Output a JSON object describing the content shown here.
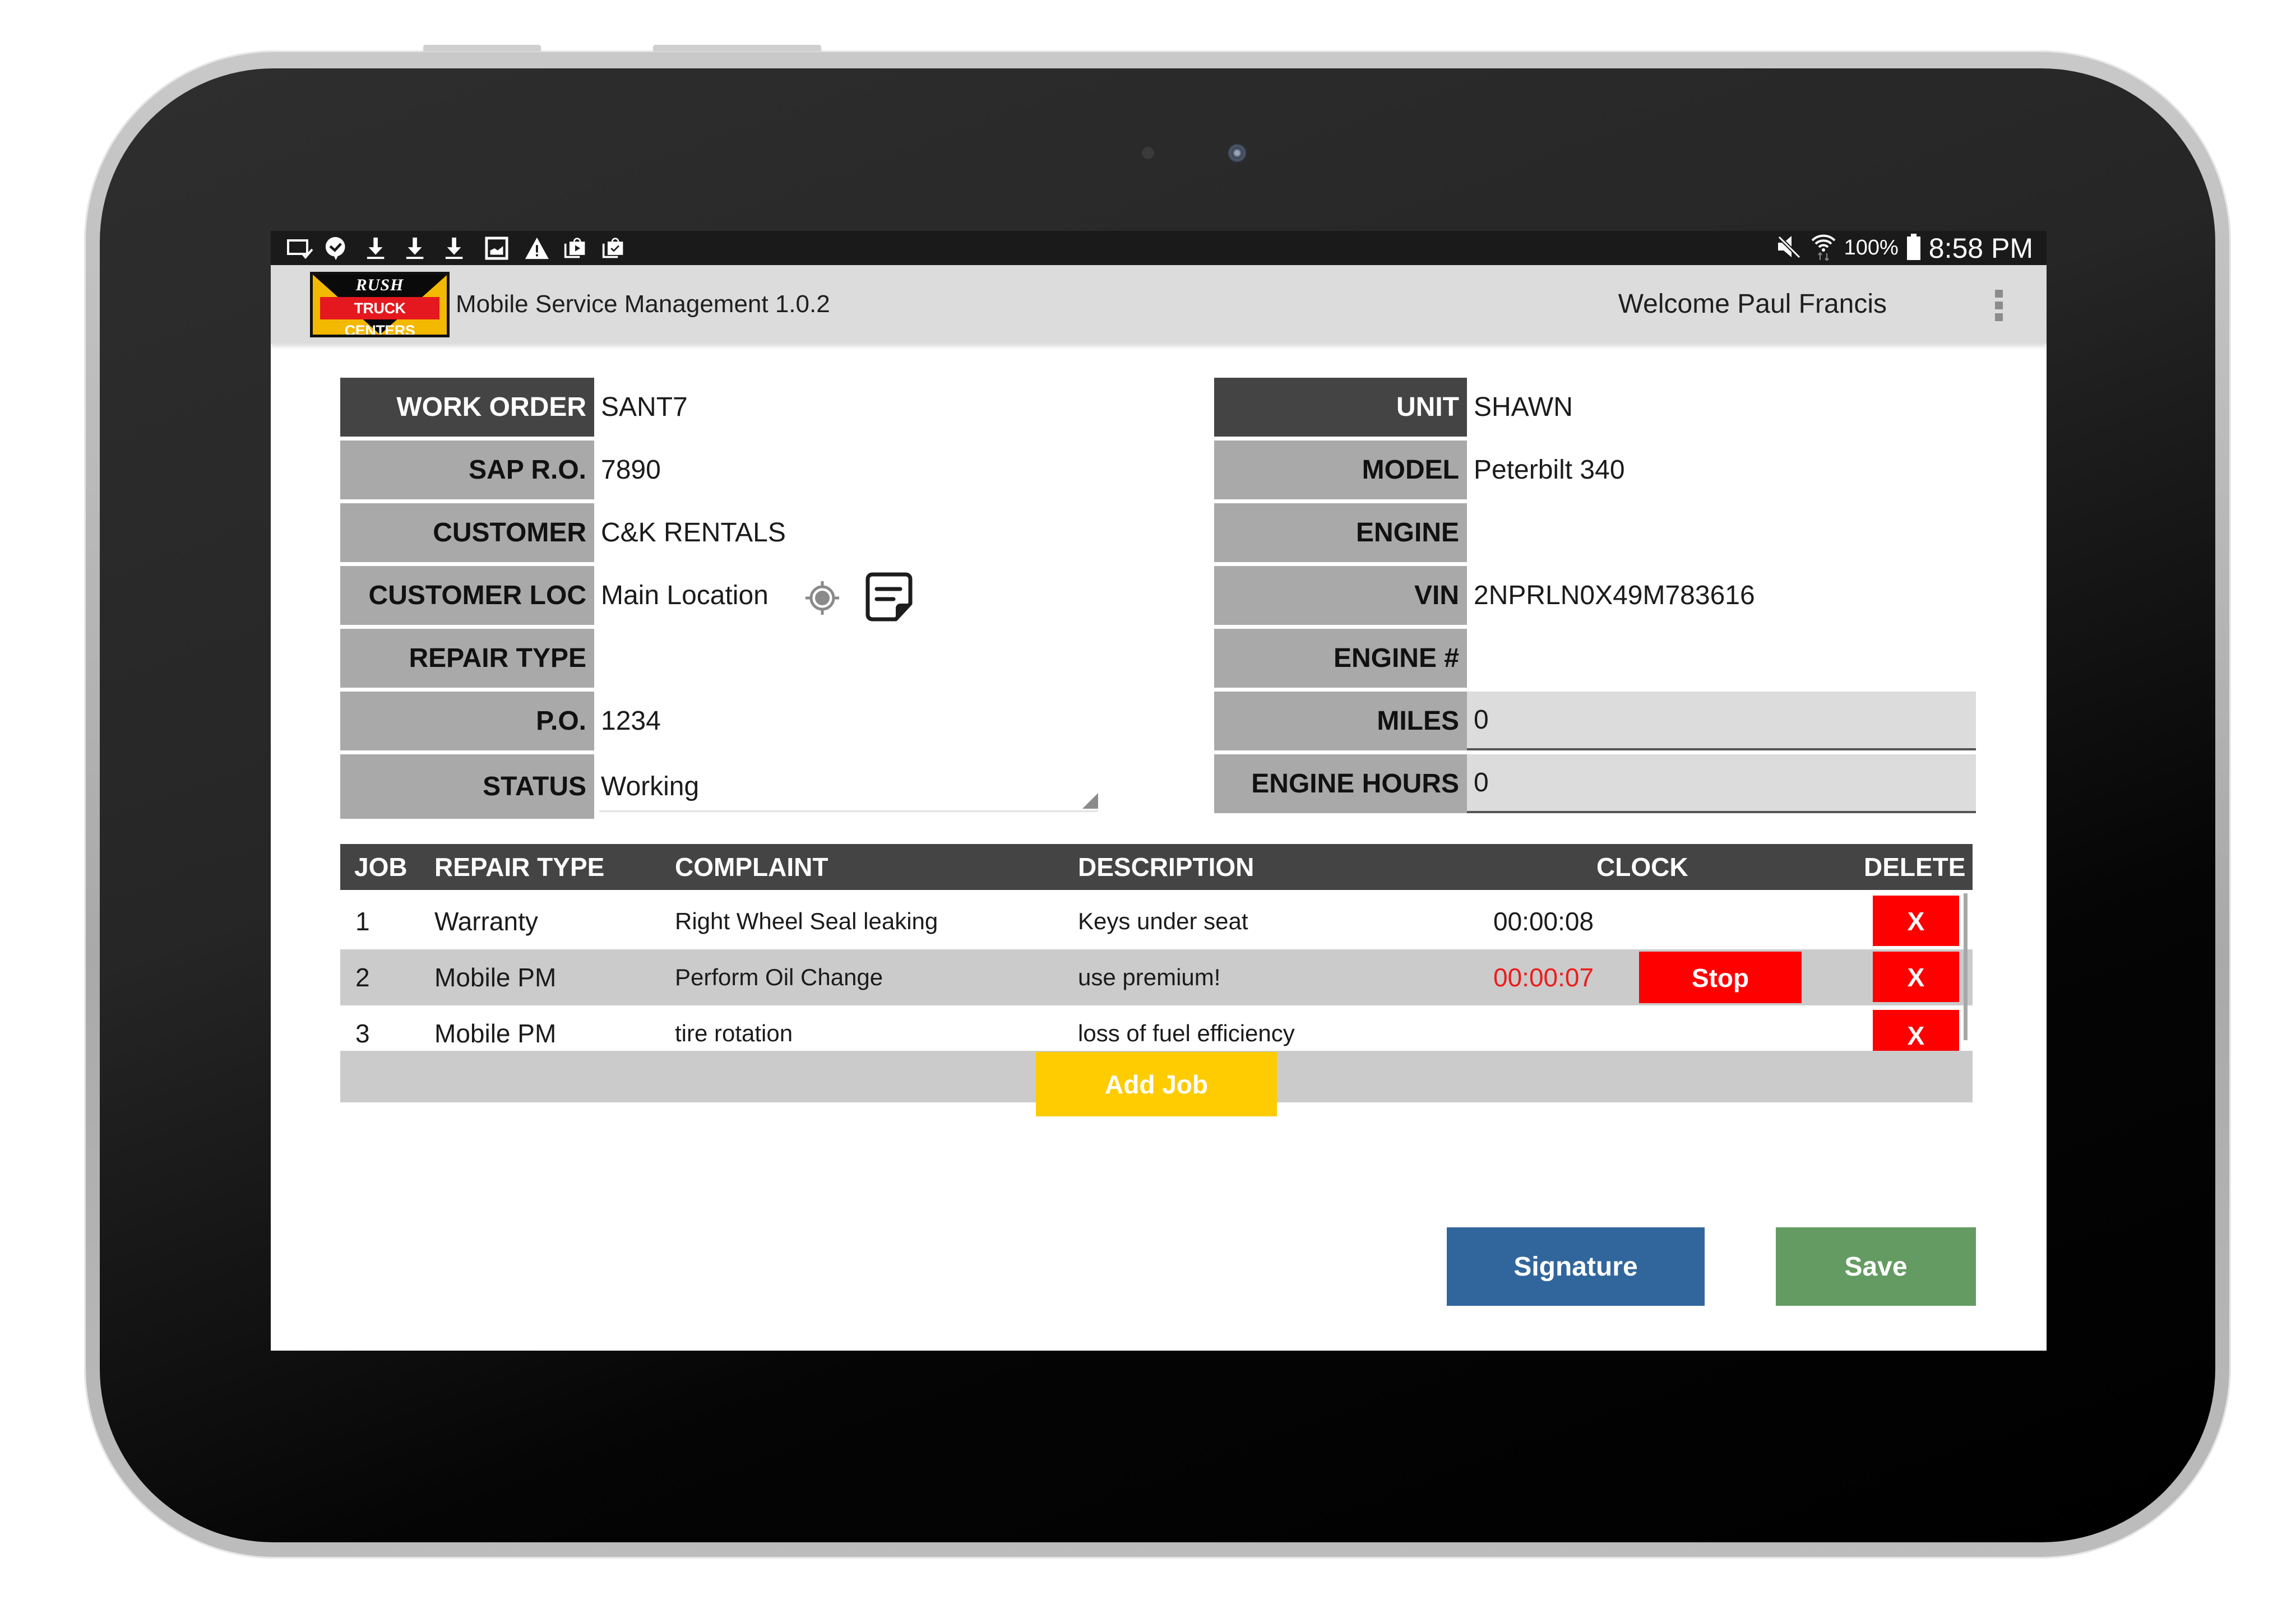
{
  "status_bar": {
    "left_icons": [
      "screen-mirror-icon",
      "chat-check-icon",
      "download-icon",
      "download-icon",
      "download-icon",
      "image-icon",
      "warning-icon",
      "store-play-icon",
      "store-check-icon"
    ],
    "right_icons": [
      "mute-icon",
      "wifi-icon",
      "battery-icon"
    ],
    "battery_percent": "100%",
    "time": "8:58 PM"
  },
  "app_bar": {
    "logo_top": "RUSH",
    "logo_band": "TRUCK CENTERS",
    "title": "Mobile Service Management 1.0.2",
    "welcome": "Welcome Paul Francis",
    "menu_icon": "overflow-menu-icon"
  },
  "work_order_form": {
    "left": [
      {
        "label": "WORK ORDER",
        "value": "SANT7"
      },
      {
        "label": "SAP R.O.",
        "value": "7890"
      },
      {
        "label": "CUSTOMER",
        "value": "C&K RENTALS"
      },
      {
        "label": "CUSTOMER LOC",
        "value": "Main Location"
      },
      {
        "label": "REPAIR TYPE",
        "value": ""
      },
      {
        "label": "P.O.",
        "value": "1234"
      },
      {
        "label": "STATUS",
        "value": "Working"
      }
    ],
    "right": [
      {
        "label": "UNIT",
        "value": "SHAWN"
      },
      {
        "label": "MODEL",
        "value": "Peterbilt 340"
      },
      {
        "label": "ENGINE",
        "value": ""
      },
      {
        "label": "VIN",
        "value": "2NPRLN0X49M783616"
      },
      {
        "label": "ENGINE #",
        "value": ""
      },
      {
        "label": "MILES",
        "value": "0"
      },
      {
        "label": "ENGINE HOURS",
        "value": "0"
      }
    ]
  },
  "jobs_table": {
    "headers": {
      "job": "JOB",
      "repair_type": "REPAIR TYPE",
      "complaint": "COMPLAINT",
      "description": "DESCRIPTION",
      "clock": "CLOCK",
      "delete": "DELETE"
    },
    "rows": [
      {
        "job": "1",
        "repair_type": "Warranty",
        "complaint": "Right Wheel Seal leaking",
        "description": "Keys under seat",
        "clock": "00:00:08",
        "running": false,
        "delete_label": "X"
      },
      {
        "job": "2",
        "repair_type": "Mobile PM",
        "complaint": "Perform Oil Change",
        "description": "use premium!",
        "clock": "00:00:07",
        "running": true,
        "stop_label": "Stop",
        "delete_label": "X"
      },
      {
        "job": "3",
        "repair_type": "Mobile PM",
        "complaint": "tire rotation",
        "description": "loss of fuel efficiency",
        "clock": "",
        "running": false,
        "delete_label": "X"
      }
    ],
    "add_job_label": "Add Job"
  },
  "actions": {
    "signature_label": "Signature",
    "save_label": "Save"
  },
  "colors": {
    "label_dark": "#444444",
    "label_gray": "#a9a9a9",
    "stop_red": "#fe0000",
    "running_clock": "#ee1c1c",
    "add_job_yellow": "#fecc00",
    "signature_blue": "#31669c",
    "save_green": "#649b62"
  }
}
